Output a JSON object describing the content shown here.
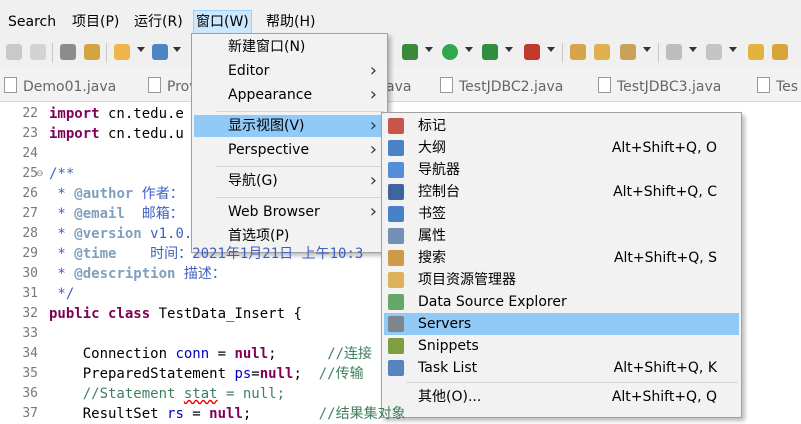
{
  "menubar": {
    "items": [
      {
        "label": "Search",
        "active": false
      },
      {
        "label": "项目(P)",
        "active": false
      },
      {
        "label": "运行(R)",
        "active": false
      },
      {
        "label": "窗口(W)",
        "active": true
      },
      {
        "label": "帮助(H)",
        "active": false
      }
    ]
  },
  "tabs": [
    {
      "label": "Demo01.java"
    },
    {
      "label": "Prov"
    },
    {
      "label": "ava"
    },
    {
      "label": "TestJDBC2.java"
    },
    {
      "label": "TestJDBC3.java"
    },
    {
      "label": "Tes"
    }
  ],
  "code": {
    "lines": [
      {
        "n": "22",
        "html": "<span class=\"kw\">import</span> cn.tedu.e"
      },
      {
        "n": "23",
        "html": "<span class=\"kw\">import</span> cn.tedu.u"
      },
      {
        "n": "24",
        "html": ""
      },
      {
        "n": "25",
        "html": "<span class=\"cm\">/**</span>",
        "fold": true
      },
      {
        "n": "26",
        "html": "<span class=\"cm\"> * </span><span class=\"tag\">@author</span><span class=\"cm\"> 作者：</span>"
      },
      {
        "n": "27",
        "html": "<span class=\"cm\"> * </span><span class=\"tag\">@email</span><span class=\"cm\">  邮箱：</span>"
      },
      {
        "n": "28",
        "html": "<span class=\"cm\"> * </span><span class=\"tag\">@version</span><span class=\"cm\"> v1.0.</span>"
      },
      {
        "n": "29",
        "html": "<span class=\"cm\"> * </span><span class=\"tag\">@time</span><span class=\"cm\">    时间：2021年1月21日 上午10:3</span>"
      },
      {
        "n": "30",
        "html": "<span class=\"cm\"> * </span><span class=\"tag\">@description</span><span class=\"cm\"> 描述：</span>"
      },
      {
        "n": "31",
        "html": "<span class=\"cm\"> */</span>"
      },
      {
        "n": "32",
        "html": "<span class=\"kw\">public class</span> TestData_Insert {"
      },
      {
        "n": "33",
        "html": ""
      },
      {
        "n": "34",
        "html": "    Connection <span style=\"color:#0000c0\">conn</span> = <span class=\"kw\">null</span>;      <span class=\"lc\">//连接</span>"
      },
      {
        "n": "35",
        "html": "    PreparedStatement <span style=\"color:#0000c0\">ps</span>=<span class=\"kw\">null</span>;  <span class=\"lc\">//传输</span>"
      },
      {
        "n": "36",
        "html": "    <span class=\"lc\">//Statement <span class=\"squig\">stat</span> = null;</span>"
      },
      {
        "n": "37",
        "html": "    ResultSet <span style=\"color:#0000c0\">rs</span> = <span class=\"kw\">null</span>;        <span class=\"lc\">//结果集对象</span>"
      }
    ]
  },
  "window_menu": {
    "items": [
      {
        "type": "item",
        "label": "新建窗口(N)"
      },
      {
        "type": "item",
        "label": "Editor",
        "submenu": true
      },
      {
        "type": "item",
        "label": "Appearance",
        "submenu": true
      },
      {
        "type": "sep"
      },
      {
        "type": "item",
        "label": "显示视图(V)",
        "submenu": true,
        "highlight": true
      },
      {
        "type": "item",
        "label": "Perspective",
        "submenu": true
      },
      {
        "type": "sep"
      },
      {
        "type": "item",
        "label": "导航(G)",
        "submenu": true
      },
      {
        "type": "sep"
      },
      {
        "type": "item",
        "label": "Web Browser",
        "submenu": true
      },
      {
        "type": "item",
        "label": "首选项(P)"
      }
    ]
  },
  "show_view_menu": {
    "items": [
      {
        "type": "item",
        "label": "标记",
        "shortcut": "",
        "icon": "markers-icon",
        "color": "#c0392b"
      },
      {
        "type": "item",
        "label": "大纲",
        "shortcut": "Alt+Shift+Q, O",
        "icon": "outline-icon",
        "color": "#2e6fbd"
      },
      {
        "type": "item",
        "label": "导航器",
        "shortcut": "",
        "icon": "navigator-icon",
        "color": "#3a7bd5"
      },
      {
        "type": "item",
        "label": "控制台",
        "shortcut": "Alt+Shift+Q, C",
        "icon": "console-icon",
        "color": "#1f4e8c"
      },
      {
        "type": "item",
        "label": "书签",
        "shortcut": "",
        "icon": "bookmarks-icon",
        "color": "#2d6cc0"
      },
      {
        "type": "item",
        "label": "属性",
        "shortcut": "",
        "icon": "properties-icon",
        "color": "#5a7fa8"
      },
      {
        "type": "item",
        "label": "搜索",
        "shortcut": "Alt+Shift+Q, S",
        "icon": "search-icon",
        "color": "#c98a2a"
      },
      {
        "type": "item",
        "label": "项目资源管理器",
        "shortcut": "",
        "icon": "project-explorer-icon",
        "color": "#d9a441"
      },
      {
        "type": "item",
        "label": "Data Source Explorer",
        "shortcut": "",
        "icon": "data-source-icon",
        "color": "#4f9a4f"
      },
      {
        "type": "item",
        "label": "Servers",
        "shortcut": "",
        "icon": "servers-icon",
        "color": "#7a7a7a",
        "highlight": true
      },
      {
        "type": "item",
        "label": "Snippets",
        "shortcut": "",
        "icon": "snippets-icon",
        "color": "#6b8e23"
      },
      {
        "type": "item",
        "label": "Task List",
        "shortcut": "Alt+Shift+Q, K",
        "icon": "task-list-icon",
        "color": "#3b6fb6"
      },
      {
        "type": "sep"
      },
      {
        "type": "item",
        "label": "其他(O)...",
        "shortcut": "Alt+Shift+Q, Q",
        "icon": "",
        "color": ""
      }
    ]
  }
}
